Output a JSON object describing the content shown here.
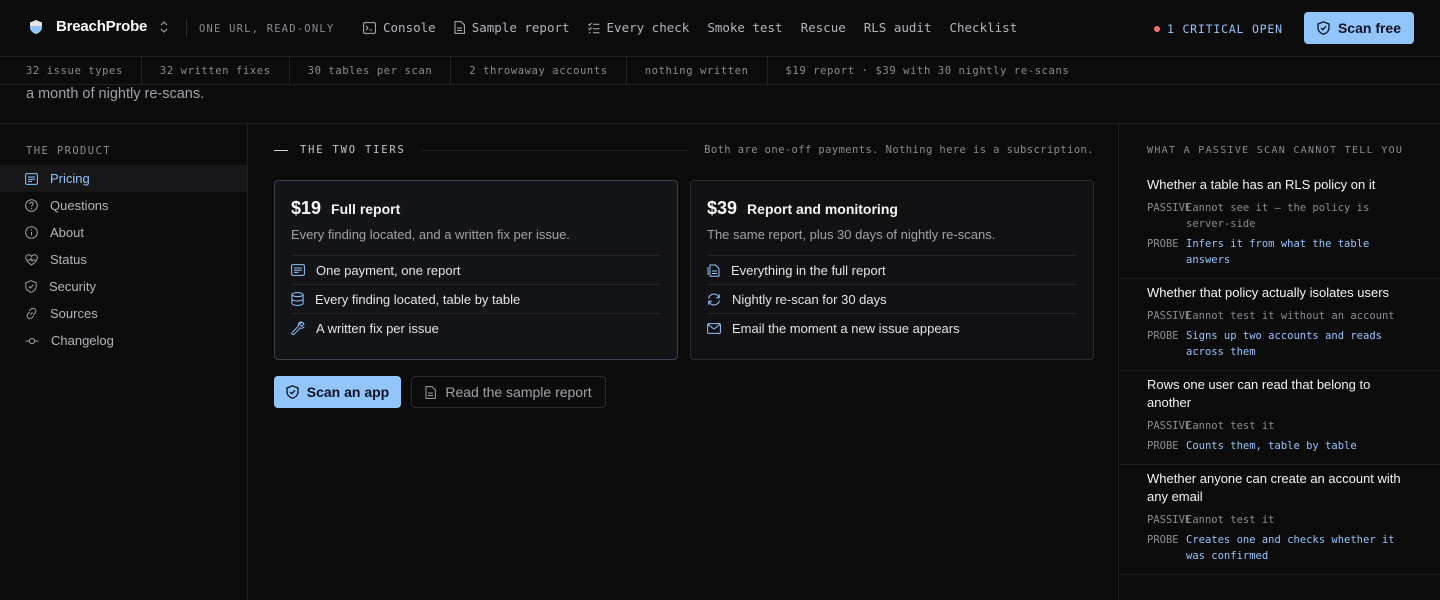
{
  "header": {
    "brand": "BreachProbe",
    "tagline": "ONE URL, READ-ONLY",
    "nav": [
      {
        "label": "Console",
        "icon": "terminal-icon"
      },
      {
        "label": "Sample report",
        "icon": "document-icon"
      },
      {
        "label": "Every check",
        "icon": "checklist-icon"
      },
      {
        "label": "Smoke test",
        "icon": ""
      },
      {
        "label": "Rescue",
        "icon": ""
      },
      {
        "label": "RLS audit",
        "icon": ""
      },
      {
        "label": "Checklist",
        "icon": ""
      }
    ],
    "critical": "1 CRITICAL OPEN",
    "cta": "Scan free"
  },
  "stats": [
    "32 issue types",
    "32 written fixes",
    "30 tables per scan",
    "2 throwaway accounts",
    "nothing written",
    "$19 report · $39 with 30 nightly re-scans"
  ],
  "intro_tail": "a month of nightly re-scans.",
  "sidebar": {
    "heading": "THE PRODUCT",
    "items": [
      {
        "label": "Pricing",
        "icon": "receipt-icon",
        "active": true
      },
      {
        "label": "Questions",
        "icon": "question-icon",
        "active": false
      },
      {
        "label": "About",
        "icon": "info-icon",
        "active": false
      },
      {
        "label": "Status",
        "icon": "heart-pulse-icon",
        "active": false
      },
      {
        "label": "Security",
        "icon": "shield-icon",
        "active": false
      },
      {
        "label": "Sources",
        "icon": "link-icon",
        "active": false
      },
      {
        "label": "Changelog",
        "icon": "commit-icon",
        "active": false
      }
    ]
  },
  "tiers": {
    "title": "THE TWO TIERS",
    "note": "Both are one-off payments. Nothing here is a subscription.",
    "cards": [
      {
        "price": "$19",
        "name": "Full report",
        "desc": "Every finding located, and a written fix per issue.",
        "rows": [
          {
            "label": "One payment, one report",
            "icon": "receipt-icon"
          },
          {
            "label": "Every finding located, table by table",
            "icon": "database-icon"
          },
          {
            "label": "A written fix per issue",
            "icon": "wrench-icon"
          }
        ]
      },
      {
        "price": "$39",
        "name": "Report and monitoring",
        "desc": "The same report, plus 30 days of nightly re-scans.",
        "rows": [
          {
            "label": "Everything in the full report",
            "icon": "files-icon"
          },
          {
            "label": "Nightly re-scan for 30 days",
            "icon": "refresh-icon"
          },
          {
            "label": "Email the moment a new issue appears",
            "icon": "mail-icon"
          }
        ]
      }
    ],
    "primary_button": "Scan an app",
    "secondary_button": "Read the sample report"
  },
  "limits": {
    "heading": "WHAT A PASSIVE SCAN CANNOT TELL YOU",
    "passive_tag": "PASSIVE",
    "probe_tag": "PROBE",
    "items": [
      {
        "question": "Whether a table has an RLS policy on it",
        "passive": "Cannot see it — the policy is server-side",
        "probe": "Infers it from what the table answers"
      },
      {
        "question": "Whether that policy actually isolates users",
        "passive": "Cannot test it without an account",
        "probe": "Signs up two accounts and reads across them"
      },
      {
        "question": "Rows one user can read that belong to another",
        "passive": "Cannot test it",
        "probe": "Counts them, table by table"
      },
      {
        "question": "Whether anyone can create an account with any email",
        "passive": "Cannot test it",
        "probe": "Creates one and checks whether it was confirmed"
      }
    ]
  },
  "colors": {
    "accent": "#93c5fd",
    "critical_dot": "#f87171",
    "background": "#0b0b0c"
  }
}
